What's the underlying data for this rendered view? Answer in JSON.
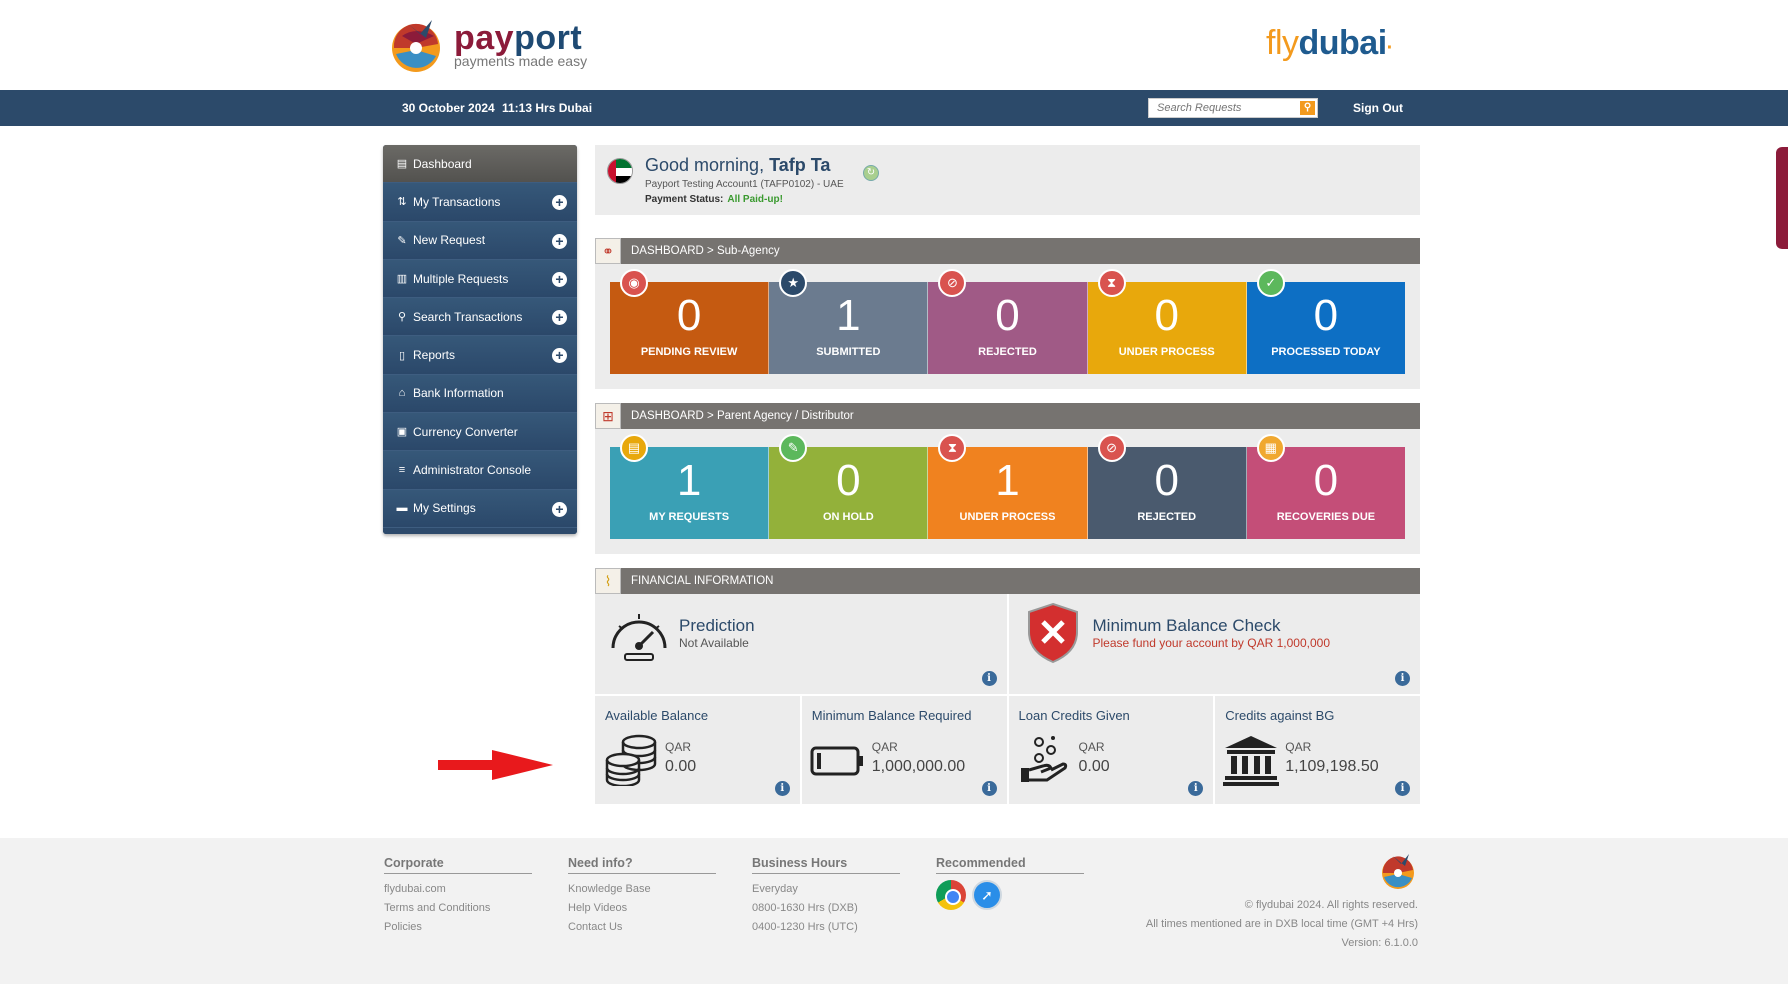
{
  "header": {
    "brand_pay": "pay",
    "brand_port": "port",
    "brand_tagline": "payments made easy",
    "airline_fly": "fly",
    "airline_dubai": "dubai",
    "airline_dot": "·"
  },
  "topbar": {
    "date": "30 October 2024",
    "time": "11:13 Hrs Dubai",
    "search_placeholder": "Search Requests",
    "signout": "Sign Out"
  },
  "sidebar": {
    "items": [
      {
        "label": "Dashboard",
        "icon": "dashboard-icon",
        "active": true
      },
      {
        "label": "My Transactions",
        "icon": "transactions-icon",
        "expandable": true
      },
      {
        "label": "New Request",
        "icon": "edit-icon",
        "expandable": true
      },
      {
        "label": "Multiple Requests",
        "icon": "multiple-icon",
        "expandable": true
      },
      {
        "label": "Search Transactions",
        "icon": "search-icon",
        "expandable": true
      },
      {
        "label": "Reports",
        "icon": "report-icon",
        "expandable": true
      },
      {
        "label": "Bank Information",
        "icon": "bank-icon"
      },
      {
        "label": "Currency Converter",
        "icon": "currency-icon"
      },
      {
        "label": "Administrator Console",
        "icon": "database-icon"
      },
      {
        "label": "My Settings",
        "icon": "briefcase-icon",
        "expandable": true
      }
    ]
  },
  "greeting": {
    "salutation": "Good morning,",
    "name": "Tafp Ta",
    "account": "Payport Testing Account1 (TAFP0102) - UAE",
    "status_label": "Payment Status:",
    "status_value": "All Paid-up!"
  },
  "subagency": {
    "title": "DASHBOARD > Sub-Agency",
    "tiles": [
      {
        "value": "0",
        "label": "PENDING REVIEW",
        "color": "#c55a11",
        "badge_color": "#d9534f",
        "icon": "eye-icon"
      },
      {
        "value": "1",
        "label": "SUBMITTED",
        "color": "#6b7b8f",
        "badge_color": "#2c4a6a",
        "icon": "star-icon"
      },
      {
        "value": "0",
        "label": "REJECTED",
        "color": "#a05a86",
        "badge_color": "#d9534f",
        "icon": "forbidden-icon"
      },
      {
        "value": "0",
        "label": "UNDER PROCESS",
        "color": "#e8a80c",
        "badge_color": "#d9534f",
        "icon": "hourglass-icon"
      },
      {
        "value": "0",
        "label": "PROCESSED TODAY",
        "color": "#0d6fc4",
        "badge_color": "#5cb85c",
        "icon": "thumbs-up-icon"
      }
    ]
  },
  "parent": {
    "title": "DASHBOARD > Parent Agency / Distributor",
    "tiles": [
      {
        "value": "1",
        "label": "MY REQUESTS",
        "color": "#3aa0b5",
        "badge_color": "#e8a80c",
        "icon": "clipboard-icon"
      },
      {
        "value": "0",
        "label": "ON HOLD",
        "color": "#93b13a",
        "badge_color": "#5cb85c",
        "icon": "pen-icon"
      },
      {
        "value": "1",
        "label": "UNDER PROCESS",
        "color": "#f0821f",
        "badge_color": "#d9534f",
        "icon": "hourglass-icon"
      },
      {
        "value": "0",
        "label": "REJECTED",
        "color": "#4a5a6e",
        "badge_color": "#d9534f",
        "icon": "forbidden-icon"
      },
      {
        "value": "0",
        "label": "RECOVERIES DUE",
        "color": "#c44e78",
        "badge_color": "#f0a830",
        "icon": "calendar-icon"
      }
    ]
  },
  "financial": {
    "title": "FINANCIAL INFORMATION",
    "prediction_title": "Prediction",
    "prediction_sub": "Not Available",
    "minbal_title": "Minimum Balance Check",
    "minbal_sub": "Please fund your account by QAR 1,000,000",
    "balances": [
      {
        "title": "Available Balance",
        "currency": "QAR",
        "value": "0.00",
        "icon": "coins-icon"
      },
      {
        "title": "Minimum Balance Required",
        "currency": "QAR",
        "value": "1,000,000.00",
        "icon": "battery-icon"
      },
      {
        "title": "Loan Credits Given",
        "currency": "QAR",
        "value": "0.00",
        "icon": "hand-coins-icon"
      },
      {
        "title": "Credits against BG",
        "currency": "QAR",
        "value": "1,109,198.50",
        "icon": "bank-building-icon"
      }
    ]
  },
  "footer": {
    "corporate": {
      "title": "Corporate",
      "links": [
        "flydubai.com",
        "Terms and Conditions",
        "Policies"
      ]
    },
    "info": {
      "title": "Need info?",
      "links": [
        "Knowledge Base",
        "Help Videos",
        "Contact Us"
      ]
    },
    "hours": {
      "title": "Business Hours",
      "lines": [
        "Everyday",
        "0800-1630 Hrs (DXB)",
        "0400-1230 Hrs (UTC)"
      ]
    },
    "recommended": {
      "title": "Recommended"
    },
    "copyright": "© flydubai 2024. All rights reserved.",
    "timezone": "All times mentioned are in DXB local time (GMT +4 Hrs)",
    "version": "Version: 6.1.0.0"
  }
}
